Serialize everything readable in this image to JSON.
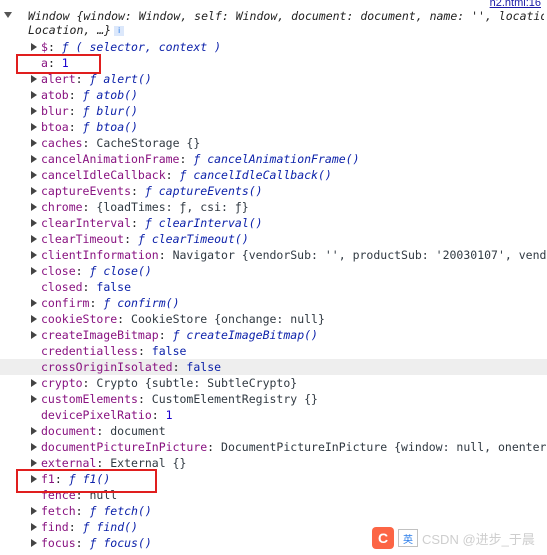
{
  "source_link": "h2.html:16",
  "header": {
    "line1": "Window {window: Window, self: Window, document: document, name: '', location:",
    "line2": "Location, …}",
    "info_badge": "i"
  },
  "rows": [
    {
      "key": "$",
      "sep": ": ",
      "sym": "ƒ",
      "val": " ( selector, context )",
      "arrow": true,
      "vtype": "fn"
    },
    {
      "key": "a",
      "sep": ": ",
      "sym": "",
      "val": "1",
      "arrow": false,
      "vtype": "num"
    },
    {
      "key": "alert",
      "sep": ": ",
      "sym": "ƒ",
      "val": " alert()",
      "arrow": true,
      "vtype": "fn"
    },
    {
      "key": "atob",
      "sep": ": ",
      "sym": "ƒ",
      "val": " atob()",
      "arrow": true,
      "vtype": "fn"
    },
    {
      "key": "blur",
      "sep": ": ",
      "sym": "ƒ",
      "val": " blur()",
      "arrow": true,
      "vtype": "fn"
    },
    {
      "key": "btoa",
      "sep": ": ",
      "sym": "ƒ",
      "val": " btoa()",
      "arrow": true,
      "vtype": "fn"
    },
    {
      "key": "caches",
      "sep": ": ",
      "sym": "",
      "val": "CacheStorage {}",
      "arrow": true,
      "vtype": "obj"
    },
    {
      "key": "cancelAnimationFrame",
      "sep": ": ",
      "sym": "ƒ",
      "val": " cancelAnimationFrame()",
      "arrow": true,
      "vtype": "fn"
    },
    {
      "key": "cancelIdleCallback",
      "sep": ": ",
      "sym": "ƒ",
      "val": " cancelIdleCallback()",
      "arrow": true,
      "vtype": "fn"
    },
    {
      "key": "captureEvents",
      "sep": ": ",
      "sym": "ƒ",
      "val": " captureEvents()",
      "arrow": true,
      "vtype": "fn"
    },
    {
      "key": "chrome",
      "sep": ": ",
      "sym": "",
      "val": "{loadTimes: ƒ, csi: ƒ}",
      "arrow": true,
      "vtype": "obj"
    },
    {
      "key": "clearInterval",
      "sep": ": ",
      "sym": "ƒ",
      "val": " clearInterval()",
      "arrow": true,
      "vtype": "fn"
    },
    {
      "key": "clearTimeout",
      "sep": ": ",
      "sym": "ƒ",
      "val": " clearTimeout()",
      "arrow": true,
      "vtype": "fn"
    },
    {
      "key": "clientInformation",
      "sep": ": ",
      "sym": "",
      "val": "Navigator {vendorSub: '', productSub: '20030107', vendor: 'G",
      "arrow": true,
      "vtype": "obj"
    },
    {
      "key": "close",
      "sep": ": ",
      "sym": "ƒ",
      "val": " close()",
      "arrow": true,
      "vtype": "fn"
    },
    {
      "key": "closed",
      "sep": ": ",
      "sym": "",
      "val": "false",
      "arrow": false,
      "vtype": "bool"
    },
    {
      "key": "confirm",
      "sep": ": ",
      "sym": "ƒ",
      "val": " confirm()",
      "arrow": true,
      "vtype": "fn"
    },
    {
      "key": "cookieStore",
      "sep": ": ",
      "sym": "",
      "val": "CookieStore {onchange: null}",
      "arrow": true,
      "vtype": "obj"
    },
    {
      "key": "createImageBitmap",
      "sep": ": ",
      "sym": "ƒ",
      "val": " createImageBitmap()",
      "arrow": true,
      "vtype": "fn"
    },
    {
      "key": "credentialless",
      "sep": ": ",
      "sym": "",
      "val": "false",
      "arrow": false,
      "vtype": "bool"
    },
    {
      "key": "crossOriginIsolated",
      "sep": ": ",
      "sym": "",
      "val": "false",
      "arrow": false,
      "vtype": "bool",
      "shaded": true
    },
    {
      "key": "crypto",
      "sep": ": ",
      "sym": "",
      "val": "Crypto {subtle: SubtleCrypto}",
      "arrow": true,
      "vtype": "obj"
    },
    {
      "key": "customElements",
      "sep": ": ",
      "sym": "",
      "val": "CustomElementRegistry {}",
      "arrow": true,
      "vtype": "obj"
    },
    {
      "key": "devicePixelRatio",
      "sep": ": ",
      "sym": "",
      "val": "1",
      "arrow": false,
      "vtype": "num"
    },
    {
      "key": "document",
      "sep": ": ",
      "sym": "",
      "val": "document",
      "arrow": true,
      "vtype": "obj"
    },
    {
      "key": "documentPictureInPicture",
      "sep": ": ",
      "sym": "",
      "val": "DocumentPictureInPicture {window: null, onenter: null",
      "arrow": true,
      "vtype": "obj"
    },
    {
      "key": "external",
      "sep": ": ",
      "sym": "",
      "val": "External {}",
      "arrow": true,
      "vtype": "obj"
    },
    {
      "key": "f1",
      "sep": ": ",
      "sym": "ƒ",
      "val": " f1()",
      "arrow": true,
      "vtype": "fn"
    },
    {
      "key": "fence",
      "sep": ": ",
      "sym": "",
      "val": "null",
      "arrow": false,
      "vtype": "obj"
    },
    {
      "key": "fetch",
      "sep": ": ",
      "sym": "ƒ",
      "val": " fetch()",
      "arrow": true,
      "vtype": "fn"
    },
    {
      "key": "find",
      "sep": ": ",
      "sym": "ƒ",
      "val": " find()",
      "arrow": true,
      "vtype": "fn"
    },
    {
      "key": "focus",
      "sep": ": ",
      "sym": "ƒ",
      "val": " focus()",
      "arrow": true,
      "vtype": "fn"
    }
  ],
  "watermark": {
    "logo": "C",
    "text": "CSDN @进步_于晨",
    "ime": "英"
  },
  "colors": {
    "key": "#881280",
    "function": "#0d22aa",
    "number": "#1c00cf",
    "highlight": "#e01e1e"
  }
}
